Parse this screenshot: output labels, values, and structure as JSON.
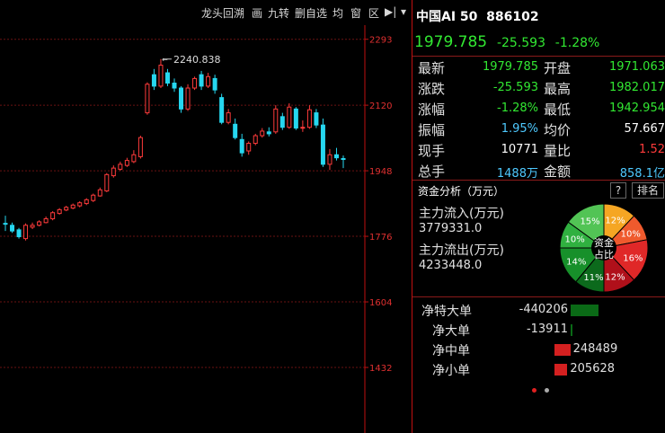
{
  "toolbar": {
    "items": [
      "龙头回溯",
      "画",
      "九转",
      "删自选",
      "均",
      "窗",
      "区",
      "▶|",
      "▾"
    ]
  },
  "chart_data": {
    "type": "candlestick",
    "y_ticks": [
      "2293",
      "2120",
      "1948",
      "1776",
      "1604",
      "1432"
    ],
    "ylim": [
      1260,
      2330
    ],
    "high_annotation": "2240.838",
    "candles": [
      {
        "o": 1810,
        "h": 1830,
        "l": 1790,
        "c": 1808
      },
      {
        "o": 1805,
        "h": 1812,
        "l": 1785,
        "c": 1790
      },
      {
        "o": 1793,
        "h": 1798,
        "l": 1770,
        "c": 1775
      },
      {
        "o": 1770,
        "h": 1810,
        "l": 1765,
        "c": 1805
      },
      {
        "o": 1800,
        "h": 1812,
        "l": 1795,
        "c": 1805
      },
      {
        "o": 1805,
        "h": 1818,
        "l": 1802,
        "c": 1814
      },
      {
        "o": 1812,
        "h": 1828,
        "l": 1810,
        "c": 1822
      },
      {
        "o": 1822,
        "h": 1842,
        "l": 1818,
        "c": 1838
      },
      {
        "o": 1836,
        "h": 1850,
        "l": 1833,
        "c": 1846
      },
      {
        "o": 1845,
        "h": 1856,
        "l": 1842,
        "c": 1852
      },
      {
        "o": 1850,
        "h": 1862,
        "l": 1847,
        "c": 1858
      },
      {
        "o": 1856,
        "h": 1868,
        "l": 1852,
        "c": 1864
      },
      {
        "o": 1862,
        "h": 1876,
        "l": 1858,
        "c": 1872
      },
      {
        "o": 1870,
        "h": 1888,
        "l": 1866,
        "c": 1884
      },
      {
        "o": 1882,
        "h": 1904,
        "l": 1880,
        "c": 1898
      },
      {
        "o": 1895,
        "h": 1942,
        "l": 1892,
        "c": 1938
      },
      {
        "o": 1935,
        "h": 1962,
        "l": 1930,
        "c": 1955
      },
      {
        "o": 1952,
        "h": 1972,
        "l": 1948,
        "c": 1965
      },
      {
        "o": 1962,
        "h": 1982,
        "l": 1958,
        "c": 1975
      },
      {
        "o": 1972,
        "h": 2002,
        "l": 1968,
        "c": 1990
      },
      {
        "o": 1985,
        "h": 2040,
        "l": 1980,
        "c": 2035
      },
      {
        "o": 2100,
        "h": 2180,
        "l": 2095,
        "c": 2175
      },
      {
        "o": 2200,
        "h": 2215,
        "l": 2160,
        "c": 2170
      },
      {
        "o": 2170,
        "h": 2241,
        "l": 2165,
        "c": 2225
      },
      {
        "o": 2205,
        "h": 2215,
        "l": 2170,
        "c": 2178
      },
      {
        "o": 2178,
        "h": 2190,
        "l": 2155,
        "c": 2165
      },
      {
        "o": 2165,
        "h": 2170,
        "l": 2100,
        "c": 2110
      },
      {
        "o": 2110,
        "h": 2175,
        "l": 2105,
        "c": 2165
      },
      {
        "o": 2165,
        "h": 2195,
        "l": 2160,
        "c": 2190
      },
      {
        "o": 2200,
        "h": 2210,
        "l": 2160,
        "c": 2170
      },
      {
        "o": 2170,
        "h": 2205,
        "l": 2165,
        "c": 2195
      },
      {
        "o": 2190,
        "h": 2200,
        "l": 2150,
        "c": 2160
      },
      {
        "o": 2140,
        "h": 2150,
        "l": 2070,
        "c": 2075
      },
      {
        "o": 2075,
        "h": 2110,
        "l": 2070,
        "c": 2100
      },
      {
        "o": 2070,
        "h": 2085,
        "l": 2030,
        "c": 2035
      },
      {
        "o": 2030,
        "h": 2045,
        "l": 1985,
        "c": 1995
      },
      {
        "o": 2000,
        "h": 2025,
        "l": 1990,
        "c": 2020
      },
      {
        "o": 2020,
        "h": 2045,
        "l": 2015,
        "c": 2040
      },
      {
        "o": 2040,
        "h": 2060,
        "l": 2035,
        "c": 2052
      },
      {
        "o": 2050,
        "h": 2062,
        "l": 2038,
        "c": 2045
      },
      {
        "o": 2050,
        "h": 2120,
        "l": 2045,
        "c": 2110
      },
      {
        "o": 2090,
        "h": 2100,
        "l": 2055,
        "c": 2062
      },
      {
        "o": 2062,
        "h": 2125,
        "l": 2058,
        "c": 2115
      },
      {
        "o": 2110,
        "h": 2115,
        "l": 2055,
        "c": 2060
      },
      {
        "o": 2060,
        "h": 2080,
        "l": 2050,
        "c": 2062
      },
      {
        "o": 2062,
        "h": 2120,
        "l": 2058,
        "c": 2108
      },
      {
        "o": 2100,
        "h": 2110,
        "l": 2060,
        "c": 2068
      },
      {
        "o": 2068,
        "h": 2085,
        "l": 1958,
        "c": 1965
      },
      {
        "o": 1965,
        "h": 2005,
        "l": 1950,
        "c": 1990
      },
      {
        "o": 1990,
        "h": 2008,
        "l": 1975,
        "c": 1982
      },
      {
        "o": 1980,
        "h": 1988,
        "l": 1955,
        "c": 1979
      }
    ]
  },
  "quote": {
    "name": "中国AI 50",
    "code": "886102",
    "price": "1979.785",
    "change": "-25.593",
    "pct": "-1.28%",
    "left": [
      {
        "label": "最新",
        "value": "1979.785",
        "color": "green"
      },
      {
        "label": "涨跌",
        "value": "-25.593",
        "color": "green"
      },
      {
        "label": "涨幅",
        "value": "-1.28%",
        "color": "green"
      },
      {
        "label": "振幅",
        "value": "1.95%",
        "color": "cyan"
      },
      {
        "label": "现手",
        "value": "10771",
        "color": "white"
      },
      {
        "label": "总手",
        "value": "1488",
        "unit": "万",
        "color": "cyan"
      }
    ],
    "right": [
      {
        "label": "开盘",
        "value": "1971.063",
        "color": "green"
      },
      {
        "label": "最高",
        "value": "1982.017",
        "color": "green"
      },
      {
        "label": "最低",
        "value": "1942.954",
        "color": "green"
      },
      {
        "label": "均价",
        "value": "57.667",
        "color": "white"
      },
      {
        "label": "量比",
        "value": "1.52",
        "color": "red"
      },
      {
        "label": "金额",
        "value": "858.1",
        "unit": "亿",
        "color": "cyan"
      }
    ]
  },
  "fund": {
    "title": "资金分析（万元）",
    "help": "?",
    "rank": "排名",
    "inflow_label": "主力流入(万元)",
    "inflow_value": "3779331.0",
    "outflow_label": "主力流出(万元)",
    "outflow_value": "4233448.0",
    "pie_center": [
      "资金",
      "占比"
    ],
    "pie": [
      {
        "value": 12,
        "label": "12%",
        "color": "#f5a623"
      },
      {
        "value": 10,
        "label": "10%",
        "color": "#ef5a2d"
      },
      {
        "value": 16,
        "label": "16%",
        "color": "#e02828"
      },
      {
        "value": 12,
        "label": "12%",
        "color": "#b0101a"
      },
      {
        "value": 11,
        "label": "11%",
        "color": "#0c6a1c"
      },
      {
        "value": 14,
        "label": "14%",
        "color": "#17902a"
      },
      {
        "value": 10,
        "label": "10%",
        "color": "#30b040"
      },
      {
        "value": 15,
        "label": "15%",
        "color": "#52c455"
      }
    ]
  },
  "flows": [
    {
      "label": "净特大单",
      "value": "-440206",
      "color": "green",
      "bar": 0.78
    },
    {
      "label": "净大单",
      "value": "-13911",
      "color": "green",
      "bar": 0.02
    },
    {
      "label": "净中单",
      "value": "248489",
      "color": "red",
      "bar": 0.44
    },
    {
      "label": "净小单",
      "value": "205628",
      "color": "red",
      "bar": 0.36
    }
  ]
}
